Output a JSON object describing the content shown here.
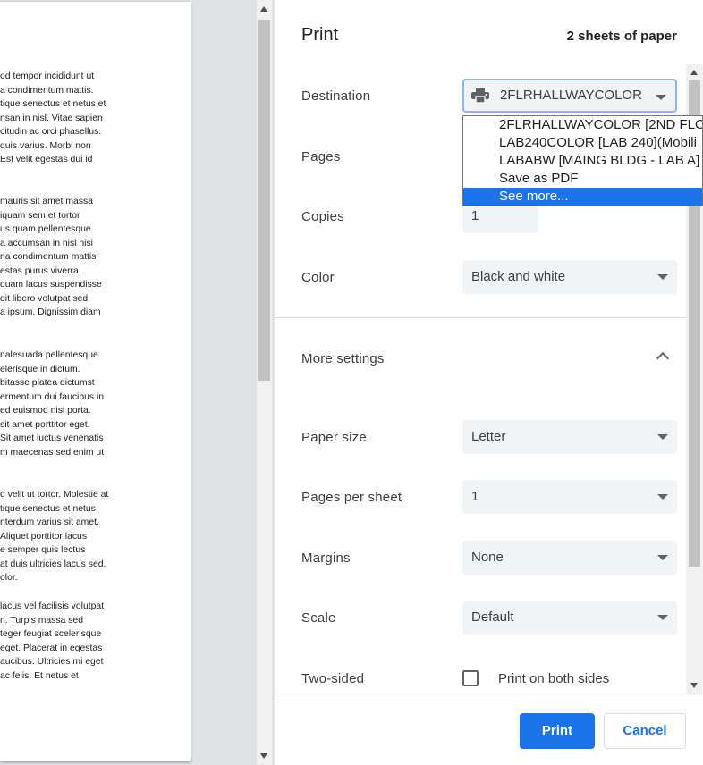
{
  "preview": {
    "paragraphs": [
      [
        "od tempor incididunt ut",
        "a condimentum mattis.",
        "tique senectus et netus et",
        "nsan in nisl. Vitae sapien",
        "citudin ac orci phasellus.",
        "quis varius. Morbi non",
        "Est velit egestas dui id"
      ],
      [
        "mauris sit amet massa",
        "iquam sem et tortor",
        "us quam pellentesque",
        "a accumsan in nisl nisi",
        "na condimentum mattis",
        "estas purus viverra.",
        "quam lacus suspendisse",
        "dit libero volutpat sed",
        "a ipsum. Dignissim diam"
      ],
      [
        "nalesuada pellentesque",
        "elerisque in dictum.",
        "bitasse platea dictumst",
        "ermentum dui faucibus in",
        "ed euismod nisi porta.",
        "sit amet porttitor eget.",
        "Sit amet luctus venenatis",
        "m maecenas sed enim ut"
      ],
      [
        "d velit ut tortor. Molestie at",
        "tique senectus et netus",
        "nterdum varius sit amet.",
        "Aliquet porttitor lacus",
        "e semper quis lectus",
        "at duis ultricies lacus sed.",
        "olor."
      ],
      [
        "lacus vel facilisis volutpat",
        "n. Turpis massa sed",
        "teger feugiat scelerisque",
        "eget. Placerat in egestas",
        "aucibus. Ultricies mi eget",
        "ac felis. Et netus et"
      ]
    ]
  },
  "header": {
    "title": "Print",
    "sheet_count": "2 sheets of paper"
  },
  "settings": {
    "destination": {
      "label": "Destination",
      "value": "2FLRHALLWAYCOLOR"
    },
    "pages": {
      "label": "Pages"
    },
    "copies": {
      "label": "Copies",
      "value": "1"
    },
    "color": {
      "label": "Color",
      "value": "Black and white"
    },
    "more_settings": {
      "label": "More settings"
    },
    "paper_size": {
      "label": "Paper size",
      "value": "Letter"
    },
    "pages_per_sheet": {
      "label": "Pages per sheet",
      "value": "1"
    },
    "margins": {
      "label": "Margins",
      "value": "None"
    },
    "scale": {
      "label": "Scale",
      "value": "Default"
    },
    "two_sided": {
      "label": "Two-sided",
      "checkbox_label": "Print on both sides",
      "checked": false
    }
  },
  "dropdown": {
    "items": [
      "2FLRHALLWAYCOLOR [2ND FLO",
      "LAB240COLOR [LAB 240](Mobili",
      "LABABW [MAING BLDG - LAB A]",
      "Save as PDF",
      "See more..."
    ],
    "selected_index": 4
  },
  "footer": {
    "print_label": "Print",
    "cancel_label": "Cancel"
  },
  "colors": {
    "accent": "#1a73e8",
    "selected_bg": "#1a73e8",
    "field_bg": "#f1f3f4"
  },
  "icons": [
    "printer-icon",
    "chevron-down-icon",
    "chevron-up-icon"
  ]
}
